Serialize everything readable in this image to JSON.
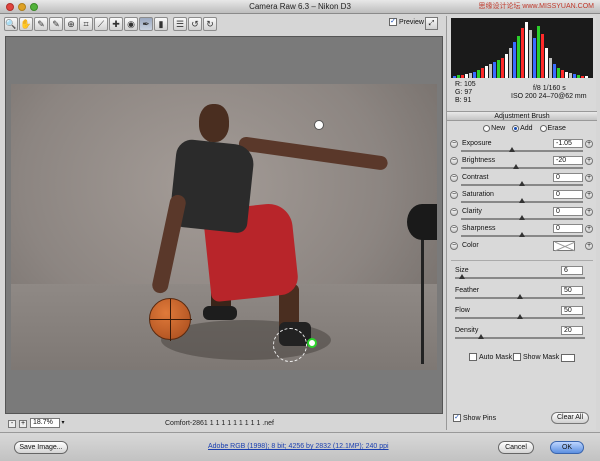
{
  "window": {
    "title": "Camera Raw 6.3  –  Nikon D3",
    "watermark": "思缘设计论坛 www.MISSYUAN.COM"
  },
  "toolbar": {
    "tools": [
      {
        "name": "zoom-tool",
        "glyph": "🔍"
      },
      {
        "name": "hand-tool",
        "glyph": "✋"
      },
      {
        "name": "white-balance-tool",
        "glyph": "✎"
      },
      {
        "name": "color-sampler-tool",
        "glyph": "✎"
      },
      {
        "name": "targeted-adjustment-tool",
        "glyph": "⊕"
      },
      {
        "name": "crop-tool",
        "glyph": "⌗"
      },
      {
        "name": "straighten-tool",
        "glyph": "⟋"
      },
      {
        "name": "spot-removal-tool",
        "glyph": "✚"
      },
      {
        "name": "red-eye-tool",
        "glyph": "◉"
      },
      {
        "name": "adjustment-brush-tool",
        "glyph": "✒"
      },
      {
        "name": "graduated-filter-tool",
        "glyph": "▮"
      },
      {
        "name": "preferences-tool",
        "glyph": "☰"
      },
      {
        "name": "rotate-left-tool",
        "glyph": "↺"
      },
      {
        "name": "rotate-right-tool",
        "glyph": "↻"
      }
    ],
    "preview_label": "Preview",
    "preview_checked": "✓"
  },
  "status": {
    "zoom_minus": "-",
    "zoom_plus": "+",
    "zoom_value": "18.7%",
    "zoom_arrow": "▾",
    "filename": "Comfort-2861 1 1 1 1 1 1 1 1 1 .nef"
  },
  "readout": {
    "r": "R:   105",
    "g": "G:    97",
    "b": "B:    91",
    "exif_line1": "f/8    1/160 s",
    "exif_line2": "ISO 200   24–70@62 mm"
  },
  "panel": {
    "title": "Adjustment Brush",
    "modes": {
      "new": "New",
      "add": "Add",
      "erase": "Erase"
    },
    "params": [
      {
        "label": "Exposure",
        "value": "-1.05",
        "level": 0.42
      },
      {
        "label": "Brightness",
        "value": "-20",
        "level": 0.45
      },
      {
        "label": "Contrast",
        "value": "0",
        "level": 0.5
      },
      {
        "label": "Saturation",
        "value": "0",
        "level": 0.5
      },
      {
        "label": "Clarity",
        "value": "0",
        "level": 0.5
      },
      {
        "label": "Sharpness",
        "value": "0",
        "level": 0.5
      }
    ],
    "color_label": "Color",
    "brush": [
      {
        "label": "Size",
        "value": "6",
        "level": 0.05
      },
      {
        "label": "Feather",
        "value": "50",
        "level": 0.5
      },
      {
        "label": "Flow",
        "value": "50",
        "level": 0.5
      },
      {
        "label": "Density",
        "value": "20",
        "level": 0.2
      }
    ],
    "auto_mask": "Auto Mask",
    "show_mask": "Show Mask",
    "show_pins": "Show Pins",
    "show_pins_checked": "✓",
    "clear_all": "Clear All"
  },
  "bottom": {
    "save_image": "Save Image...",
    "workflow": "Adobe RGB (1998); 8 bit; 4256 by 2832 (12.1MP); 240 ppi",
    "cancel": "Cancel",
    "ok": "OK"
  },
  "colors": {
    "accent": "#1a4fb5",
    "ok_button": "#5c8fe0"
  }
}
